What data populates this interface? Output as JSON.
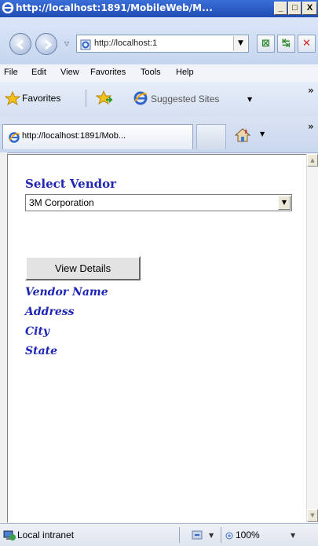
{
  "window": {
    "title": "http://localhost:1891/MobileWeb/M...",
    "minimize": "_",
    "restore": "□",
    "close": "X"
  },
  "navbar": {
    "address_url": "http://localhost:1",
    "icons": [
      "back-icon",
      "forward-icon",
      "compat-view-icon",
      "refresh-icon",
      "stop-icon"
    ]
  },
  "menu": {
    "items": [
      "File",
      "Edit",
      "View",
      "Favorites",
      "Tools",
      "Help"
    ]
  },
  "favorites_bar": {
    "favorites_label": "Favorites",
    "suggested_sites_label": "Suggested Sites"
  },
  "tab": {
    "title": "http://localhost:1891/Mob..."
  },
  "page": {
    "heading": "Select Vendor",
    "vendor_select_value": "3M Corporation",
    "view_details_label": "View Details",
    "fields": [
      "Vendor Name",
      "Address",
      "City",
      "State"
    ]
  },
  "status_bar": {
    "zone": "Local intranet",
    "zoom": "100%"
  },
  "colors": {
    "heading_blue": "#1f26b3"
  }
}
